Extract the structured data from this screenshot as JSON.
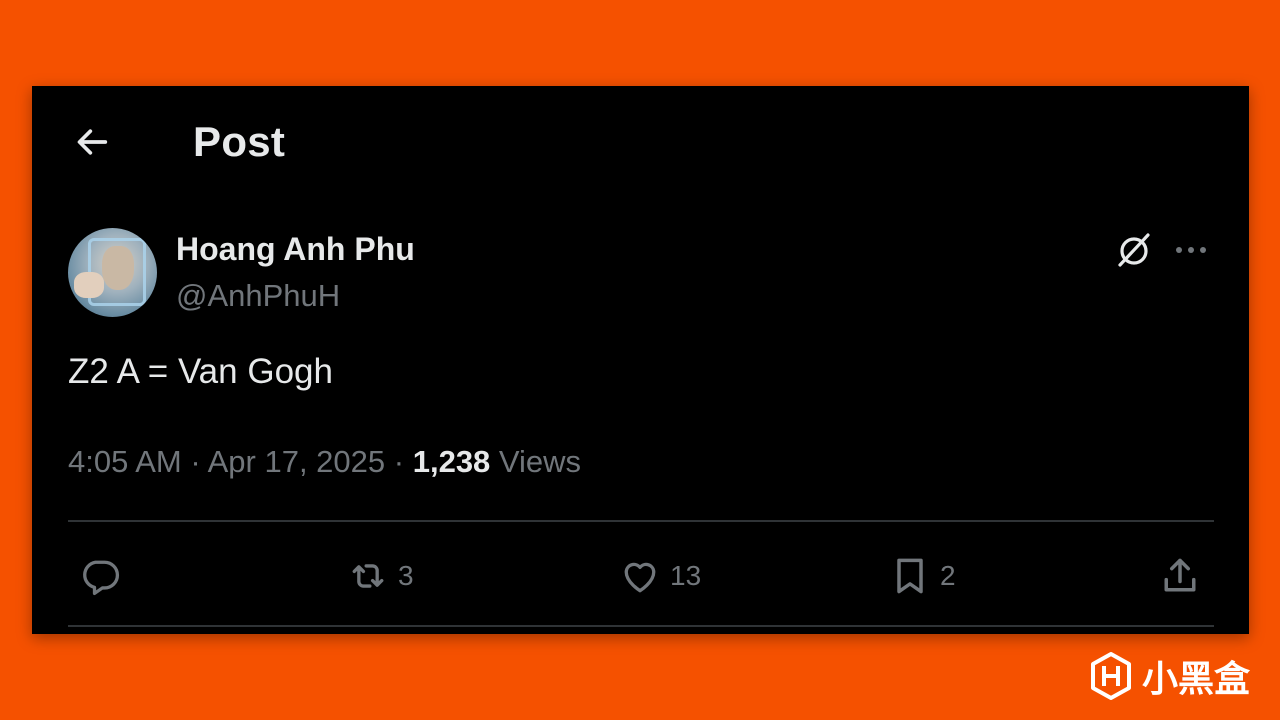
{
  "header": {
    "title": "Post"
  },
  "post": {
    "author_name": "Hoang Anh Phu",
    "author_handle": "@AnhPhuH",
    "text": "Z2 A = Van Gogh",
    "time": "4:05 AM",
    "separator": "·",
    "date": "Apr 17, 2025",
    "views_count": "1,238",
    "views_label": "Views"
  },
  "actions": {
    "reply_count": "",
    "repost_count": "3",
    "like_count": "13",
    "bookmark_count": "2"
  },
  "icons": [
    "back-arrow-icon",
    "grok-icon",
    "more-icon",
    "reply-icon",
    "repost-icon",
    "like-icon",
    "bookmark-icon",
    "share-icon"
  ],
  "colors": {
    "background": "#f55100",
    "card": "#000000",
    "text": "#e7e9ea",
    "muted": "#71767b",
    "divider": "#2f3336"
  },
  "watermark": {
    "text": "小黑盒"
  }
}
